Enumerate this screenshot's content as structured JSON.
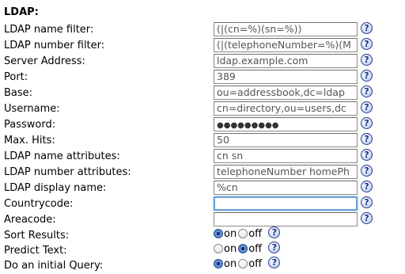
{
  "section_title": "LDAP:",
  "fields": [
    {
      "key": "name_filter",
      "label": "LDAP name filter:",
      "value": "(|(cn=%)(sn=%))"
    },
    {
      "key": "number_filter",
      "label": "LDAP number filter:",
      "value": "(|(telephoneNumber=%)(M"
    },
    {
      "key": "server_address",
      "label": "Server Address:",
      "value": "ldap.example.com"
    },
    {
      "key": "port",
      "label": "Port:",
      "value": "389"
    },
    {
      "key": "base",
      "label": "Base:",
      "value": "ou=addressbook,dc=ldap"
    },
    {
      "key": "username",
      "label": "Username:",
      "value": "cn=directory,ou=users,dc"
    },
    {
      "key": "password",
      "label": "Password:",
      "value": "●●●●●●●●●"
    },
    {
      "key": "max_hits",
      "label": "Max. Hits:",
      "value": "50"
    },
    {
      "key": "name_attributes",
      "label": "LDAP name attributes:",
      "value": "cn sn"
    },
    {
      "key": "number_attributes",
      "label": "LDAP number attributes:",
      "value": "telephoneNumber homePh"
    },
    {
      "key": "display_name",
      "label": "LDAP display name:",
      "value": "%cn"
    },
    {
      "key": "countrycode",
      "label": "Countrycode:",
      "value": ""
    },
    {
      "key": "areacode",
      "label": "Areacode:",
      "value": ""
    }
  ],
  "options": [
    {
      "key": "sort_results",
      "label": "Sort Results:",
      "on_label": "on",
      "off_label": "off",
      "selected": "on"
    },
    {
      "key": "predict_text",
      "label": "Predict Text:",
      "on_label": "on",
      "off_label": "off",
      "selected": "off"
    },
    {
      "key": "initial_query",
      "label": "Do an initial Query:",
      "on_label": "on",
      "off_label": "off",
      "selected": "on"
    }
  ],
  "help_glyph": "?",
  "icons": {
    "help": "help-icon"
  },
  "colors": {
    "help_border": "#2a3c8c",
    "focus_ring": "#6c9fd6",
    "radio_selected": "#3f73c0"
  }
}
